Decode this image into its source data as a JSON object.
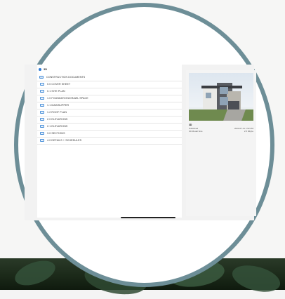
{
  "app": {
    "header_title": "3D"
  },
  "document_list": [
    {
      "label": "CONSTRUCTION DOCUMENTS",
      "type": "folder"
    },
    {
      "label": "0.0 COVER SHEET",
      "type": "sheet"
    },
    {
      "label": "0.1 SITE PLAN",
      "type": "sheet"
    },
    {
      "label": "1.0 FOUNDATION/CRAWL SPACE",
      "type": "sheet"
    },
    {
      "label": "1.1 MAINSUPPER",
      "type": "sheet"
    },
    {
      "label": "1.2 ROOF PLAN",
      "type": "sheet"
    },
    {
      "label": "2.0 ELEVATIONS",
      "type": "sheet"
    },
    {
      "label": "2.1 ELEVATIONS",
      "type": "sheet"
    },
    {
      "label": "3.0 SECTIONS",
      "type": "sheet"
    },
    {
      "label": "4.0 DETAILS + SCHEDULES",
      "type": "sheet"
    }
  ],
  "preview": {
    "title": "3D",
    "published_label": "Published",
    "published_value": "2023-07-11 1:52 PM",
    "size_label": "3D Model Size",
    "size_value": "2.5 Mbyte"
  },
  "colors": {
    "accent": "#2d7bd6",
    "bezel": "#6d8e97"
  }
}
